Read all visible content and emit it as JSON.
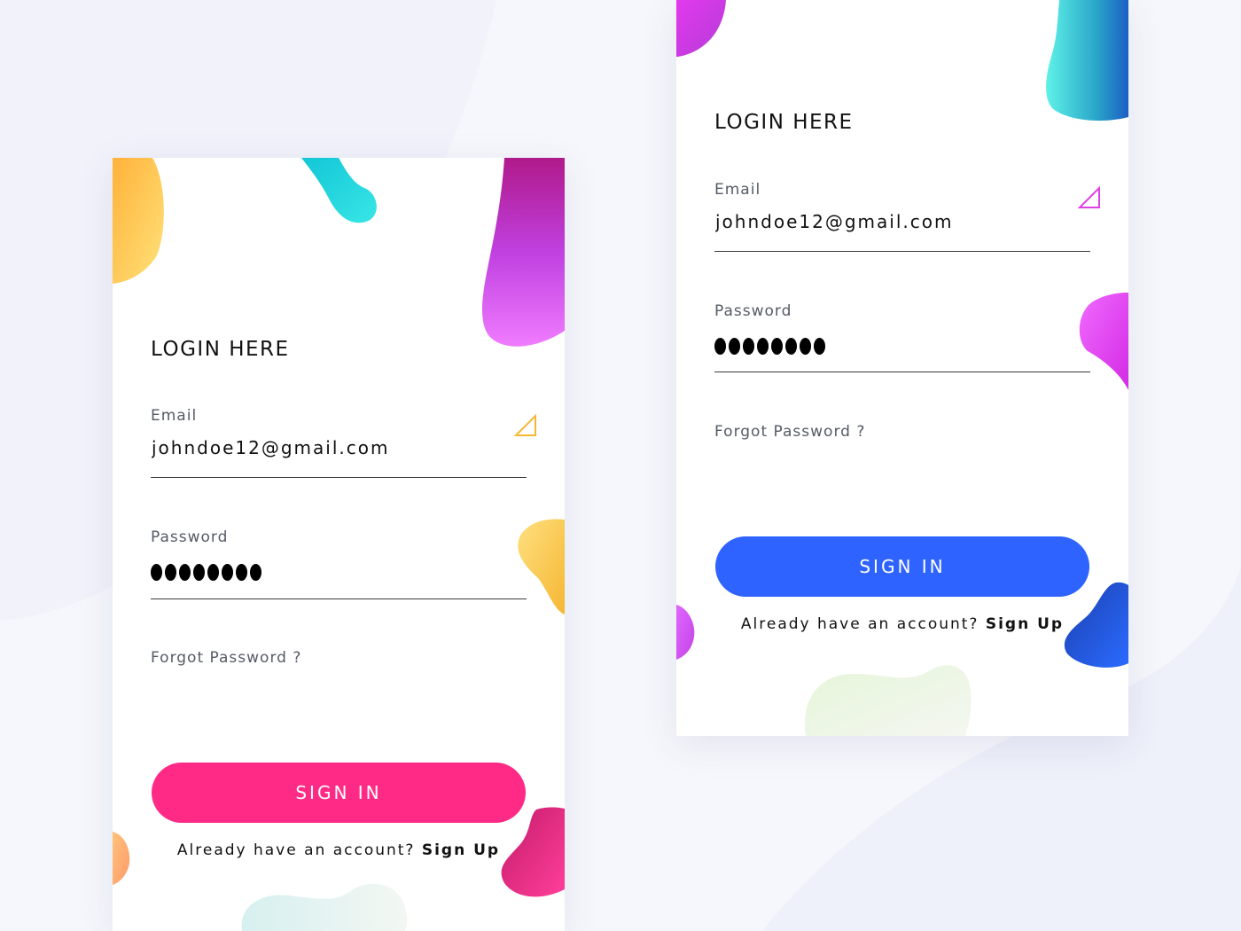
{
  "cards": [
    {
      "title": "LOGIN HERE",
      "email_label": "Email",
      "email_value": "johndoe12@gmail.com",
      "password_label": "Password",
      "password_dot_count": 8,
      "forgot_label": "Forgot Password ?",
      "signin_label": "SIGN IN",
      "account_prompt": "Already have an account?",
      "signup_label": "Sign Up",
      "accent_color": "#ff2a86",
      "check_icon": "corner-check-icon",
      "check_color": "#f7b733"
    },
    {
      "title": "LOGIN HERE",
      "email_label": "Email",
      "email_value": "johndoe12@gmail.com",
      "password_label": "Password",
      "password_dot_count": 8,
      "forgot_label": "Forgot Password ?",
      "signin_label": "SIGN IN",
      "account_prompt": "Already have an account?",
      "signup_label": "Sign Up",
      "accent_color": "#2e63ff",
      "check_icon": "corner-check-icon",
      "check_color": "#e040e8"
    }
  ]
}
